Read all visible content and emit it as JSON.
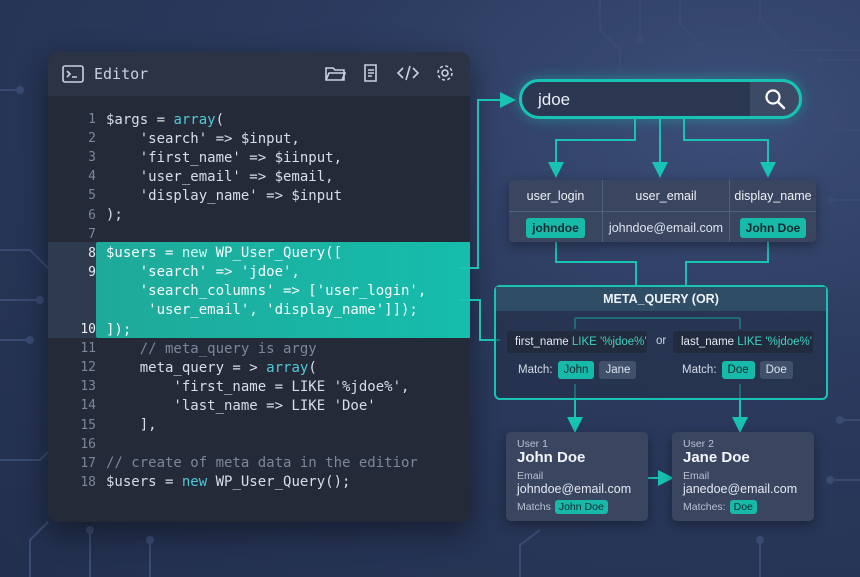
{
  "editor": {
    "title": "Editor",
    "tools": [
      "folder-icon",
      "document-icon",
      "code-icon",
      "gear-icon"
    ],
    "lines": [
      {
        "n": "1",
        "segs": [
          [
            "",
            "$args = "
          ],
          [
            "kw",
            "array"
          ],
          [
            "",
            "("
          ]
        ]
      },
      {
        "n": "2",
        "segs": [
          [
            "",
            "    'search' => $input,"
          ]
        ]
      },
      {
        "n": "3",
        "segs": [
          [
            "",
            "    'first_name' => $iinput,"
          ]
        ]
      },
      {
        "n": "4",
        "segs": [
          [
            "",
            "    'user_email' => $email,"
          ]
        ]
      },
      {
        "n": "5",
        "segs": [
          [
            "",
            "    'display_name' => $input"
          ]
        ]
      },
      {
        "n": "6",
        "segs": [
          [
            "",
            ");"
          ]
        ]
      },
      {
        "n": "7",
        "segs": [
          [
            "",
            ""
          ]
        ]
      },
      {
        "n": "8",
        "segs": [
          [
            "",
            "$users = "
          ],
          [
            "kwh",
            "new"
          ],
          [
            "",
            " WP_User_Query(["
          ]
        ]
      },
      {
        "n": "9",
        "segs": [
          [
            "",
            "    'search' => 'jdoe',"
          ]
        ]
      },
      {
        "n": "",
        "segs": [
          [
            "",
            "    'search_columns' => ['user_login',"
          ]
        ]
      },
      {
        "n": "",
        "segs": [
          [
            "",
            "     'user_email', 'display_name']]);"
          ]
        ]
      },
      {
        "n": "10",
        "segs": [
          [
            "",
            "]);"
          ]
        ]
      },
      {
        "n": "11",
        "segs": [
          [
            "cm",
            "    // meta_query is argy"
          ]
        ]
      },
      {
        "n": "12",
        "segs": [
          [
            "",
            "    meta_query = > "
          ],
          [
            "kw",
            "array"
          ],
          [
            "",
            "("
          ]
        ]
      },
      {
        "n": "13",
        "segs": [
          [
            "",
            "        'first_name = LIKE '%jdoe%',"
          ]
        ]
      },
      {
        "n": "14",
        "segs": [
          [
            "",
            "        'last_name => LIKE 'Doe'"
          ]
        ]
      },
      {
        "n": "15",
        "segs": [
          [
            "",
            "    ],"
          ]
        ]
      },
      {
        "n": "16",
        "segs": [
          [
            "",
            ""
          ]
        ]
      },
      {
        "n": "17",
        "segs": [
          [
            "cm",
            "// create of meta data in the editior"
          ]
        ]
      },
      {
        "n": "18",
        "segs": [
          [
            "",
            "$users = "
          ],
          [
            "kw",
            "new"
          ],
          [
            "",
            " WP_User_Query();"
          ]
        ]
      }
    ]
  },
  "search": {
    "value": "jdoe",
    "icon": "search-icon"
  },
  "table": {
    "columns": [
      {
        "header": "user_login",
        "value": "johndoe",
        "chip": true
      },
      {
        "header": "user_email",
        "value": "johndoe@email.com",
        "chip": false
      },
      {
        "header": "display_name",
        "value": "John Doe",
        "chip": true
      }
    ]
  },
  "meta_query": {
    "title": "META_QUERY (OR)",
    "or_label": "or",
    "cond1": {
      "field": "first_name",
      "op": "LIKE '%jdoe%'"
    },
    "cond2": {
      "field": "last_name",
      "op": "LIKE '%jdoe%'"
    },
    "match_label": "Match:",
    "match1": [
      "John",
      "Jane"
    ],
    "match2": [
      "Doe",
      "Doe"
    ]
  },
  "users": [
    {
      "label": "User 1",
      "name": "John Doe",
      "email_label": "Email",
      "email": "johndoe@email.com",
      "matches_label": "Matchs",
      "match": "John Doe"
    },
    {
      "label": "User 2",
      "name": "Jane Doe",
      "email_label": "Email",
      "email": "janedoe@email.com",
      "matches_label": "Matches:",
      "match": "Doe"
    }
  ],
  "colors": {
    "accent": "#18c3b3",
    "background": "#2b3a5e",
    "panel": "#3a4660"
  }
}
